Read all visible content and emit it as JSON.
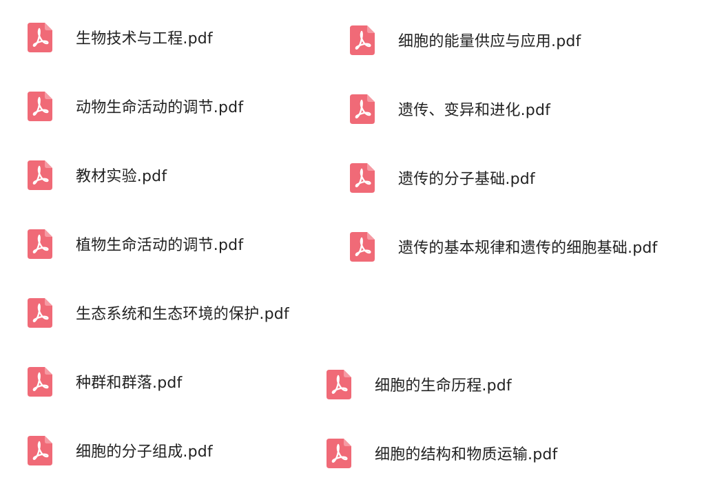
{
  "icon_color": "#f06a77",
  "icon_name": "pdf-icon",
  "files": [
    {
      "name": "生物技术与工程.pdf"
    },
    {
      "name": "动物生命活动的调节.pdf"
    },
    {
      "name": "教材实验.pdf"
    },
    {
      "name": "植物生命活动的调节.pdf"
    },
    {
      "name": "生态系统和生态环境的保护.pdf"
    },
    {
      "name": "种群和群落.pdf"
    },
    {
      "name": "细胞的分子组成.pdf"
    },
    {
      "name": "细胞的能量供应与应用.pdf"
    },
    {
      "name": "遗传、变异和进化.pdf"
    },
    {
      "name": "遗传的分子基础.pdf"
    },
    {
      "name": "遗传的基本规律和遗传的细胞基础.pdf"
    },
    {
      "name": "细胞的生命历程.pdf"
    },
    {
      "name": "细胞的结构和物质运输.pdf"
    }
  ]
}
